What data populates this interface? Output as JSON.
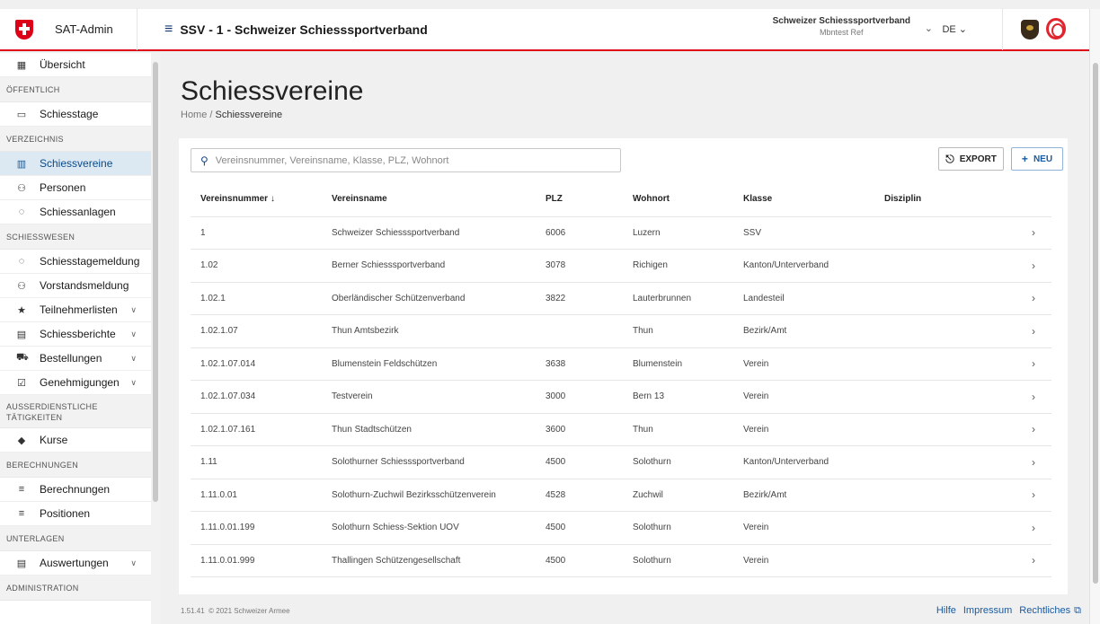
{
  "header": {
    "app_name": "SAT-Admin",
    "org_title": "SSV - 1 - Schweizer Schiesssportverband",
    "org_name": "Schweizer Schiesssportverband",
    "user": "Mbntest Ref",
    "language": "DE"
  },
  "sidebar": {
    "items": [
      {
        "type": "item",
        "label": "Übersicht",
        "icon": "dashboard-icon",
        "active": false
      },
      {
        "type": "section",
        "label": "ÖFFENTLICH"
      },
      {
        "type": "item",
        "label": "Schiesstage",
        "icon": "calendar-icon"
      },
      {
        "type": "section",
        "label": "VERZEICHNIS"
      },
      {
        "type": "item",
        "label": "Schiessvereine",
        "icon": "building-icon",
        "active": true
      },
      {
        "type": "item",
        "label": "Personen",
        "icon": "people-icon"
      },
      {
        "type": "item",
        "label": "Schiessanlagen",
        "icon": "target-icon"
      },
      {
        "type": "section",
        "label": "SCHIESSWESEN"
      },
      {
        "type": "item",
        "label": "Schiesstagemeldung",
        "icon": "target-icon"
      },
      {
        "type": "item",
        "label": "Vorstandsmeldung",
        "icon": "people-icon"
      },
      {
        "type": "item",
        "label": "Teilnehmerlisten",
        "icon": "star-icon",
        "chevron": true
      },
      {
        "type": "item",
        "label": "Schiessberichte",
        "icon": "document-icon",
        "chevron": true
      },
      {
        "type": "item",
        "label": "Bestellungen",
        "icon": "cart-icon",
        "chevron": true
      },
      {
        "type": "item",
        "label": "Genehmigungen",
        "icon": "checkbox-icon",
        "chevron": true
      },
      {
        "type": "section",
        "label": "AUSSERDIENSTLICHE TÄTIGKEITEN",
        "tall": true
      },
      {
        "type": "item",
        "label": "Kurse",
        "icon": "graduation-icon"
      },
      {
        "type": "section",
        "label": "BERECHNUNGEN"
      },
      {
        "type": "item",
        "label": "Berechnungen",
        "icon": "list-icon"
      },
      {
        "type": "item",
        "label": "Positionen",
        "icon": "list-icon"
      },
      {
        "type": "section",
        "label": "UNTERLAGEN"
      },
      {
        "type": "item",
        "label": "Auswertungen",
        "icon": "document-icon",
        "chevron": true
      },
      {
        "type": "section",
        "label": "ADMINISTRATION"
      }
    ]
  },
  "main": {
    "title": "Schiessvereine",
    "breadcrumb_home": "Home",
    "breadcrumb_sep": "/",
    "breadcrumb_current": "Schiessvereine",
    "search_placeholder": "Vereinsnummer, Vereinsname, Klasse, PLZ, Wohnort",
    "export_label": "EXPORT",
    "new_label": "NEU",
    "columns": [
      "Vereinsnummer",
      "Vereinsname",
      "PLZ",
      "Wohnort",
      "Klasse",
      "Disziplin"
    ],
    "sort_indicator": "↓",
    "rows": [
      [
        "1",
        "Schweizer Schiesssportverband",
        "6006",
        "Luzern",
        "SSV",
        ""
      ],
      [
        "1.02",
        "Berner Schiesssportverband",
        "3078",
        "Richigen",
        "Kanton/Unterverband",
        ""
      ],
      [
        "1.02.1",
        "Oberländischer Schützenverband",
        "3822",
        "Lauterbrunnen",
        "Landesteil",
        ""
      ],
      [
        "1.02.1.07",
        "Thun Amtsbezirk",
        "",
        "Thun",
        "Bezirk/Amt",
        ""
      ],
      [
        "1.02.1.07.014",
        "Blumenstein Feldschützen",
        "3638",
        "Blumenstein",
        "Verein",
        ""
      ],
      [
        "1.02.1.07.034",
        "Testverein",
        "3000",
        "Bern 13",
        "Verein",
        ""
      ],
      [
        "1.02.1.07.161",
        "Thun Stadtschützen",
        "3600",
        "Thun",
        "Verein",
        ""
      ],
      [
        "1.11",
        "Solothurner Schiesssportverband",
        "4500",
        "Solothurn",
        "Kanton/Unterverband",
        ""
      ],
      [
        "1.11.0.01",
        "Solothurn-Zuchwil Bezirksschützenverein",
        "4528",
        "Zuchwil",
        "Bezirk/Amt",
        ""
      ],
      [
        "1.11.0.01.199",
        "Solothurn Schiess-Sektion UOV",
        "4500",
        "Solothurn",
        "Verein",
        ""
      ],
      [
        "1.11.0.01.999",
        "Thallingen Schützengesellschaft",
        "4500",
        "Solothurn",
        "Verein",
        ""
      ]
    ]
  },
  "footer": {
    "version": "1.51.41",
    "copyright": "© 2021 Schweizer Armee",
    "links": [
      "Hilfe",
      "Impressum",
      "Rechtliches"
    ]
  },
  "colors": {
    "accent": "#dc0018",
    "primary": "#1a5aa0",
    "active_bg": "#dce9f2"
  }
}
